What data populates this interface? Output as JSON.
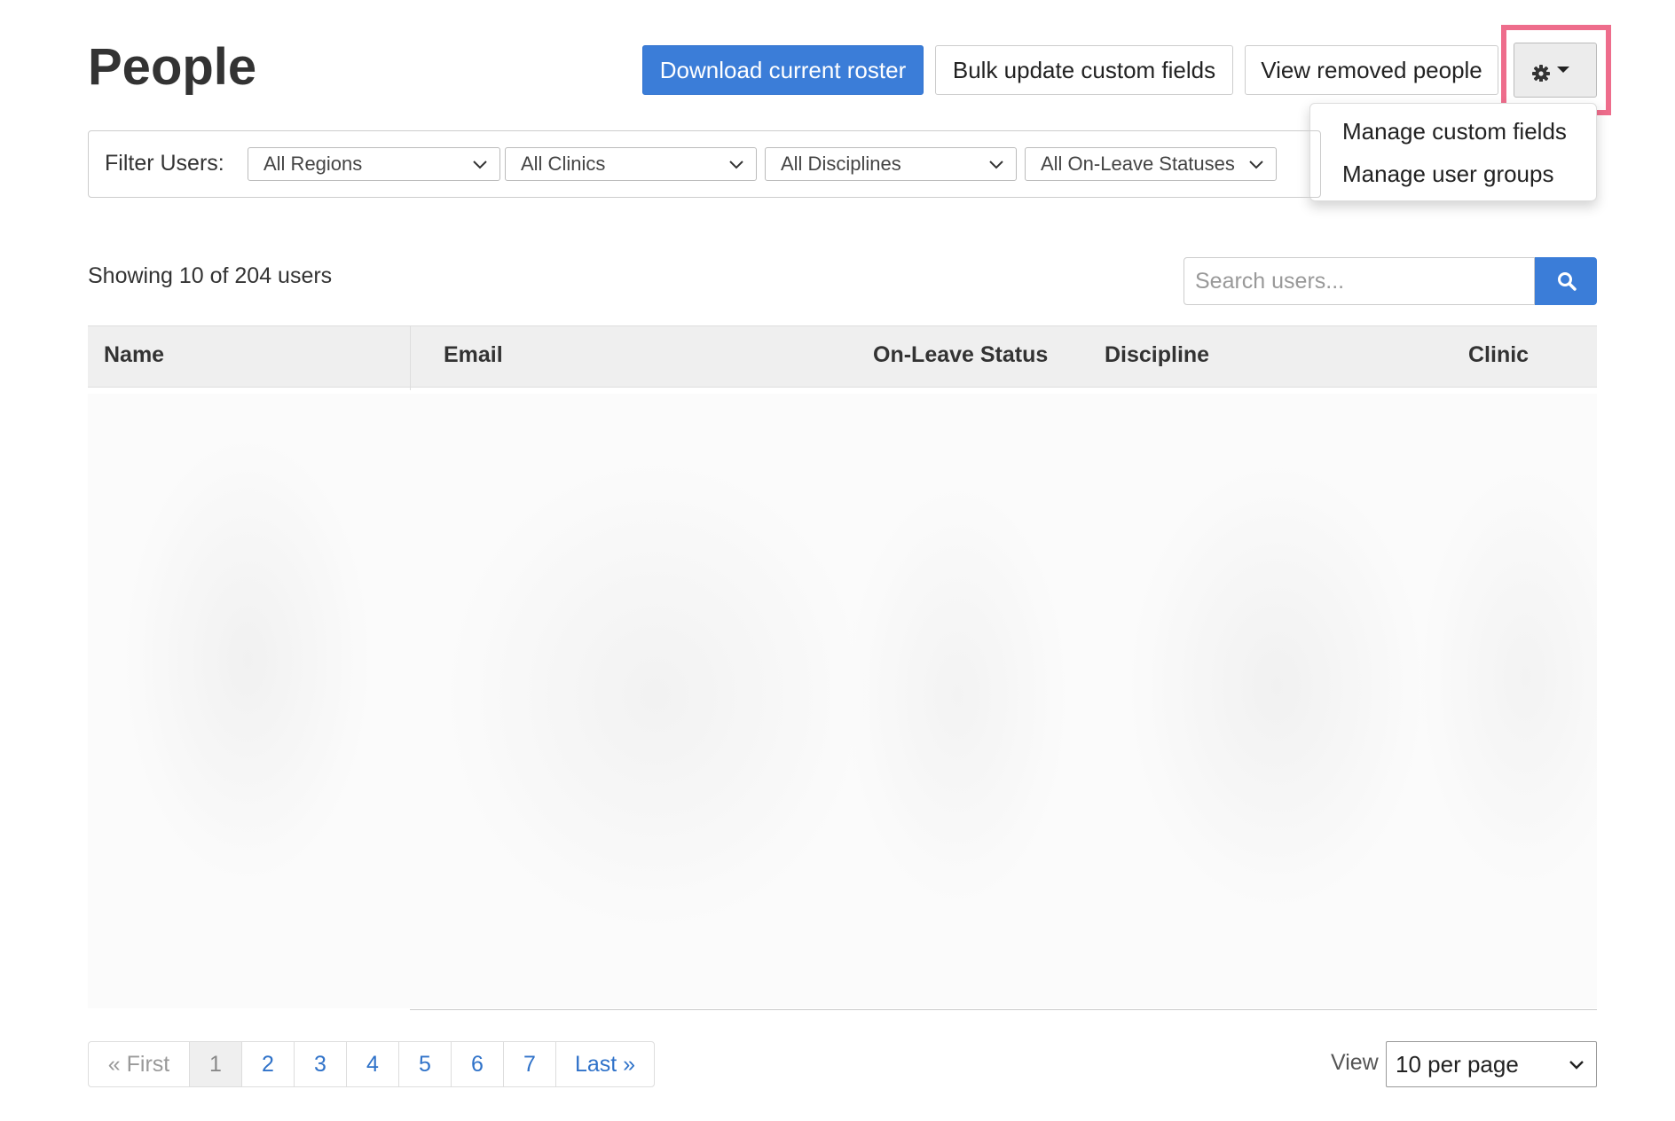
{
  "page": {
    "title": "People"
  },
  "toolbar": {
    "download_label": "Download current roster",
    "bulk_update_label": "Bulk update custom fields",
    "view_removed_label": "View removed people",
    "settings_icon": "gear-icon"
  },
  "settings_menu": {
    "items": [
      {
        "label": "Manage custom fields"
      },
      {
        "label": "Manage user groups"
      }
    ]
  },
  "filters": {
    "label": "Filter Users:",
    "regions": "All Regions",
    "clinics": "All Clinics",
    "disciplines": "All Disciplines",
    "on_leave": "All On-Leave Statuses"
  },
  "summary": {
    "showing": "Showing 10 of 204 users"
  },
  "search": {
    "placeholder": "Search users..."
  },
  "table": {
    "columns": [
      "Name",
      "Email",
      "On-Leave Status",
      "Discipline",
      "Clinic"
    ]
  },
  "pagination": {
    "first": "« First",
    "pages": [
      "1",
      "2",
      "3",
      "4",
      "5",
      "6",
      "7"
    ],
    "current": "1",
    "last": "Last »"
  },
  "per_page": {
    "label": "View",
    "value": "10 per page"
  },
  "colors": {
    "accent": "#3b7dd8",
    "highlight": "#ee6d8c"
  }
}
